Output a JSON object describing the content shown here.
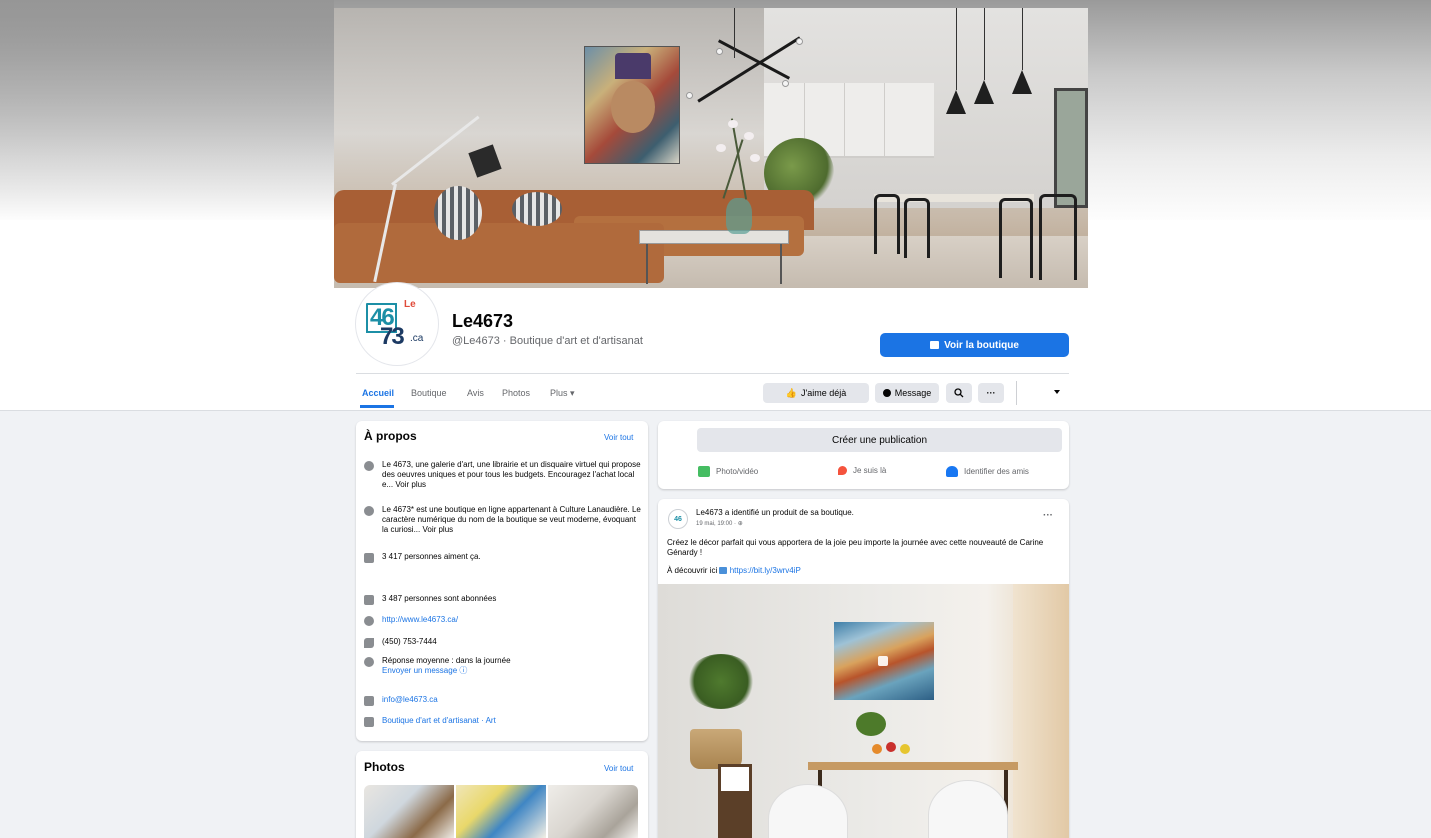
{
  "page": {
    "name": "Le4673",
    "subtitle": "@Le4673 · Boutique d'art et d'artisanat",
    "avatar": {
      "top_right": "Le",
      "top": "46",
      "bottom": "73",
      "suffix": ".ca"
    }
  },
  "header": {
    "shop_button": "Voir la boutique"
  },
  "tabs": [
    {
      "label": "Accueil",
      "active": true
    },
    {
      "label": "Boutique",
      "active": false
    },
    {
      "label": "Avis",
      "active": false
    },
    {
      "label": "Photos",
      "active": false
    },
    {
      "label": "Plus ▾",
      "active": false
    }
  ],
  "actions": {
    "like": "J'aime déjà",
    "message": "Message",
    "search_icon": "search-icon",
    "more": "···"
  },
  "about": {
    "title": "À propos",
    "see_all": "Voir tout",
    "desc1": "Le 4673, une galerie d'art, une librairie et un disquaire virtuel qui propose des oeuvres uniques et pour tous les budgets. Encouragez l'achat local e...",
    "desc1_more": "Voir plus",
    "desc2": "Le 4673* est une boutique en ligne appartenant à Culture Lanaudière. Le caractère numérique du nom de la boutique se veut moderne, évoquant la curiosi...",
    "desc2_more": "Voir plus",
    "likes": "3 417 personnes aiment ça.",
    "followers": "3 487 personnes sont abonnées",
    "website": "http://www.le4673.ca/",
    "phone": "(450) 753-7444",
    "response": "Réponse moyenne : dans la journée",
    "send_message": "Envoyer un message",
    "email": "info@le4673.ca",
    "category": "Boutique d'art et d'artisanat · Art"
  },
  "photos": {
    "title": "Photos",
    "see_all": "Voir tout"
  },
  "composer": {
    "create": "Créer une publication",
    "photo": "Photo/vidéo",
    "checkin": "Je suis là",
    "tag": "Identifier des amis"
  },
  "post": {
    "author_line": "Le4673 a identifié un produit de sa boutique.",
    "time": "19 mai, 19:00 · ⊕",
    "dots": "···",
    "text1": "Créez le décor parfait qui vous apportera de la joie peu importe la journée avec cette nouveauté de Carine Génardy !",
    "text2_prefix": "À découvrir ici",
    "text2_link": "https://bit.ly/3wrv4iP"
  },
  "colors": {
    "accent": "#1b74e4",
    "background": "#f0f2f5",
    "card": "#ffffff",
    "secondary_text": "#65676b"
  }
}
